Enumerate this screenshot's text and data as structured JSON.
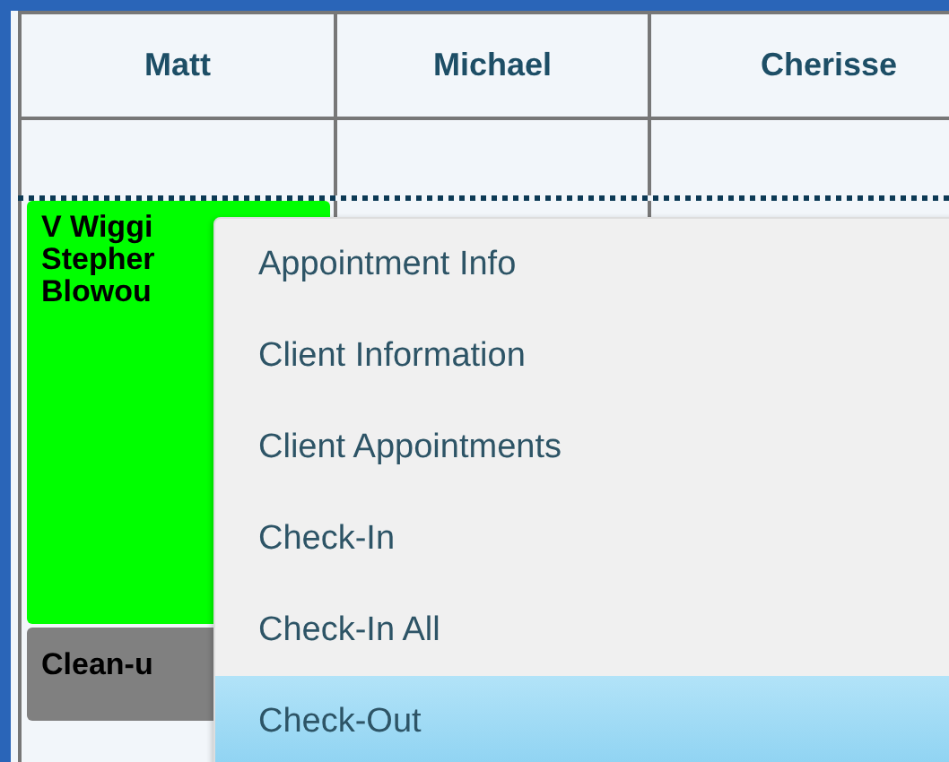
{
  "columns": [
    {
      "name": "Matt"
    },
    {
      "name": "Michael"
    },
    {
      "name": "Cherisse"
    }
  ],
  "appointments": [
    {
      "kind": "service",
      "lines": [
        "V Wiggi",
        "Stepher",
        "Blowou"
      ]
    },
    {
      "kind": "cleanup",
      "lines": [
        "Clean-u"
      ]
    }
  ],
  "context_menu": {
    "items": [
      {
        "label": "Appointment Info",
        "selected": false
      },
      {
        "label": "Client Information",
        "selected": false
      },
      {
        "label": "Client Appointments",
        "selected": false
      },
      {
        "label": "Check-In",
        "selected": false
      },
      {
        "label": "Check-In All",
        "selected": false
      },
      {
        "label": "Check-Out",
        "selected": true
      }
    ]
  }
}
